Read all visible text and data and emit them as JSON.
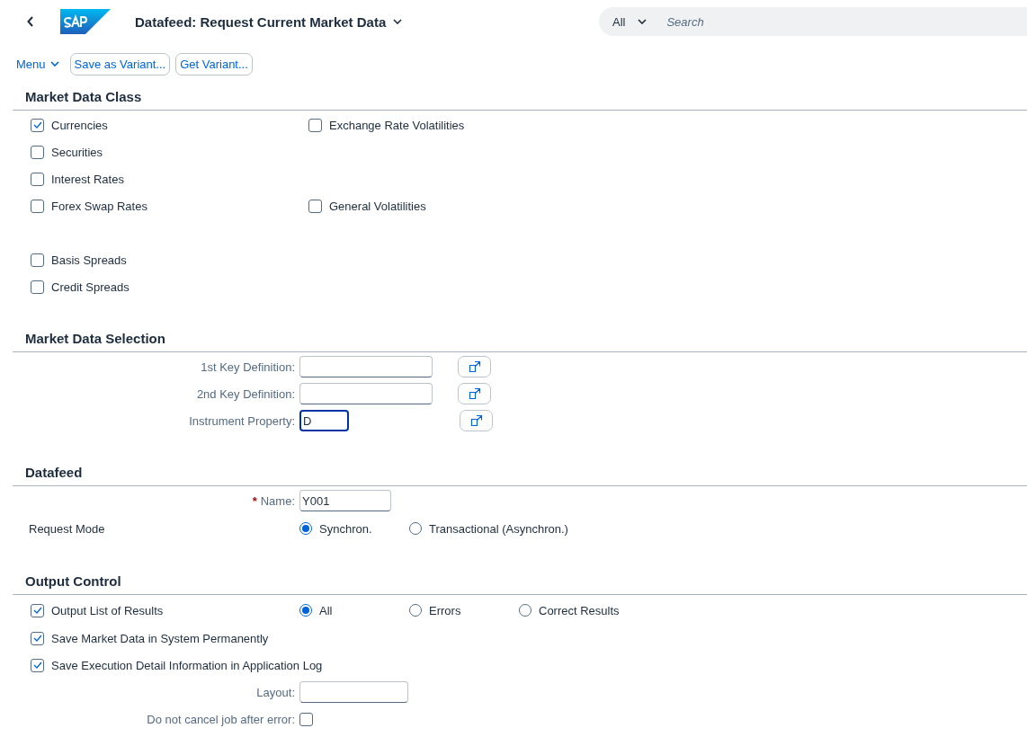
{
  "header": {
    "title": "Datafeed: Request Current Market Data",
    "search": {
      "scope": "All",
      "placeholder": "Search"
    }
  },
  "toolbar": {
    "menu": "Menu",
    "buttons": [
      "Save as Variant...",
      "Get Variant..."
    ]
  },
  "sections": [
    {
      "title": "Market Data Class",
      "rows": [
        {
          "kind": "checks",
          "items": [
            {
              "label": "Currencies",
              "checked": true
            },
            {
              "label": "Exchange Rate Volatilities",
              "checked": false
            }
          ]
        },
        {
          "kind": "checks",
          "items": [
            {
              "label": "Securities",
              "checked": false
            }
          ]
        },
        {
          "kind": "checks",
          "items": [
            {
              "label": "Interest Rates",
              "checked": false
            }
          ]
        },
        {
          "kind": "checks",
          "items": [
            {
              "label": "Forex Swap Rates",
              "checked": false
            },
            {
              "label": "General Volatilities",
              "checked": false
            }
          ]
        },
        {
          "kind": "checks",
          "items": [
            {
              "label": "Basis Spreads",
              "checked": false
            }
          ]
        },
        {
          "kind": "checks",
          "items": [
            {
              "label": "Credit Spreads",
              "checked": false
            }
          ]
        }
      ]
    },
    {
      "title": "Market Data Selection",
      "rows": [
        {
          "kind": "field",
          "label": "1st Key Definition:",
          "focused": false,
          "action": true
        },
        {
          "kind": "field",
          "label": "2nd Key Definition:",
          "focused": false,
          "action": true
        },
        {
          "kind": "field",
          "label": "Instrument Property:",
          "value": "D",
          "focused": true,
          "action": true
        }
      ]
    },
    {
      "title": "Datafeed",
      "rows": [
        {
          "kind": "field",
          "required_mark": "*",
          "label": "Name:",
          "value": "Y001",
          "focused": false,
          "action": false
        },
        {
          "kind": "radios",
          "label": "Request Mode",
          "options": [
            {
              "label": "Synchron.",
              "selected": true
            },
            {
              "label": "Transactional (Asynchron.)",
              "selected": false
            }
          ]
        }
      ]
    },
    {
      "title": "Output Control",
      "rows": [
        {
          "kind": "check_radios",
          "check": {
            "label": "Output List of Results",
            "checked": true
          },
          "options": [
            {
              "label": "All",
              "selected": true
            },
            {
              "label": "Errors",
              "selected": false
            },
            {
              "label": "Correct Results",
              "selected": false
            }
          ]
        },
        {
          "kind": "checks",
          "items": [
            {
              "label": "Save Market Data in System Permanently",
              "checked": true
            }
          ]
        },
        {
          "kind": "checks",
          "items": [
            {
              "label": "Save Execution Detail Information in Application Log",
              "checked": true
            }
          ]
        },
        {
          "kind": "field",
          "label": "Layout:",
          "focused": false,
          "action": false
        },
        {
          "kind": "label_check",
          "label": "Do not cancel job after error:",
          "checked": false
        }
      ]
    }
  ]
}
